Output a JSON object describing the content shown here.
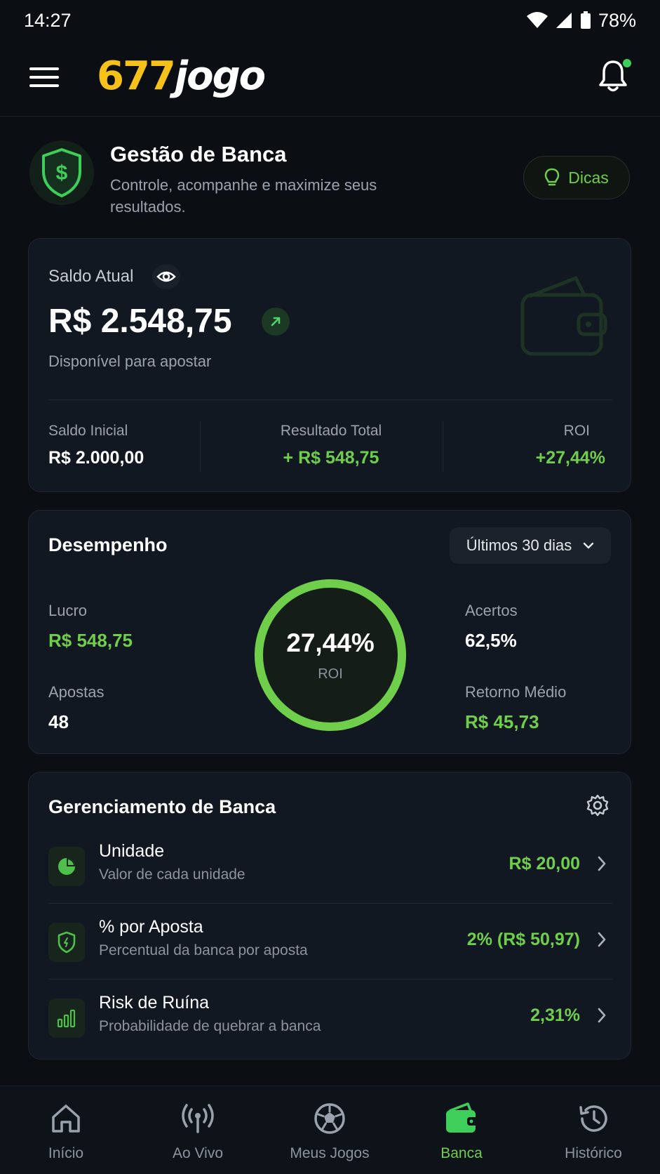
{
  "status_bar": {
    "time": "14:27",
    "battery": "78%"
  },
  "header": {
    "logo_number": "677",
    "logo_word": "jogo"
  },
  "page": {
    "title": "Gestão de Banca",
    "subtitle": "Controle, acompanhe e maximize seus resultados.",
    "tips_label": "Dicas"
  },
  "balance": {
    "label": "Saldo Atual",
    "value": "R$ 2.548,75",
    "subtitle": "Disponível para apostar",
    "stats": [
      {
        "label": "Saldo Inicial",
        "value": "R$ 2.000,00"
      },
      {
        "label": "Resultado Total",
        "value": "+ R$ 548,75"
      },
      {
        "label": "ROI",
        "value": "+27,44%"
      }
    ]
  },
  "performance": {
    "title": "Desempenho",
    "period": "Últimos 30 dias",
    "profit_label": "Lucro",
    "profit_value": "R$ 548,75",
    "bets_label": "Apostas",
    "bets_value": "48",
    "hits_label": "Acertos",
    "hits_value": "62,5%",
    "avg_return_label": "Retorno Médio",
    "avg_return_value": "R$ 45,73",
    "roi_value": "27,44%",
    "roi_label": "ROI"
  },
  "management": {
    "title": "Gerenciamento de Banca",
    "rows": [
      {
        "title": "Unidade",
        "subtitle": "Valor de cada unidade",
        "value": "R$ 20,00"
      },
      {
        "title": "% por Aposta",
        "subtitle": "Percentual da banca por aposta",
        "value": "2% (R$ 50,97)"
      },
      {
        "title": "Risk de Ruína",
        "subtitle": "Probabilidade de quebrar a banca",
        "value": "2,31%"
      }
    ]
  },
  "nav": {
    "items": [
      {
        "label": "Início",
        "icon": "home-icon"
      },
      {
        "label": "Ao Vivo",
        "icon": "live-broadcast-icon"
      },
      {
        "label": "Meus Jogos",
        "icon": "soccer-ball-icon"
      },
      {
        "label": "Banca",
        "icon": "wallet-icon"
      },
      {
        "label": "Histórico",
        "icon": "history-clock-icon"
      }
    ],
    "active": "Banca"
  },
  "colors": {
    "accent": "#6fcf4b",
    "logo_yellow": "#f6c21a",
    "background": "#0b0f14",
    "card": "#121821"
  }
}
